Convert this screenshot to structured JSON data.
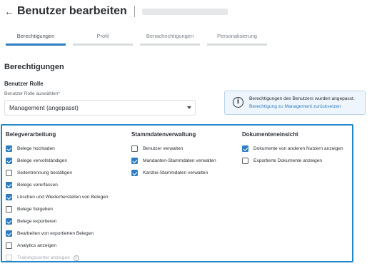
{
  "header": {
    "back_icon": "arrow-left-icon",
    "title": "Benutzer bearbeiten"
  },
  "tabs": [
    {
      "label": "Berechtigungen",
      "active": true
    },
    {
      "label": "Profil",
      "active": false
    },
    {
      "label": "Benachrichtigungen",
      "active": false
    },
    {
      "label": "Personalisierung",
      "active": false
    }
  ],
  "section_title": "Berechtigungen",
  "role": {
    "heading": "Benutzer Rolle",
    "select_label": "Benutzer Rolle auswählen*",
    "value": "Management (angepasst)"
  },
  "info": {
    "icon": "info-icon",
    "text": "Berechtigungen des Benutzers wurden angepasst.",
    "link": "Berechtigung zu Management zurücksetzen"
  },
  "columns": [
    {
      "title": "Belegverarbeitung",
      "items": [
        {
          "label": "Belege hochladen",
          "checked": true
        },
        {
          "label": "Belege vervollständigen",
          "checked": true
        },
        {
          "label": "Seitentrennung bestätigen",
          "checked": false
        },
        {
          "label": "Belege vorerfassen",
          "checked": true
        },
        {
          "label": "Löschen und Wiederherstellen von Belegen",
          "checked": true
        },
        {
          "label": "Belege freigeben",
          "checked": false
        },
        {
          "label": "Belege exportieren",
          "checked": true
        },
        {
          "label": "Bearbeiten von exportierten Belegen",
          "checked": true
        },
        {
          "label": "Analytics anzeigen",
          "checked": false
        },
        {
          "label": "Trainingscenter anzeigen",
          "checked": false,
          "disabled": true,
          "help_icon": "help-circle-icon"
        }
      ]
    },
    {
      "title": "Stammdatenverwaltung",
      "items": [
        {
          "label": "Benutzer verwalten",
          "checked": false
        },
        {
          "label": "Mandanten-Stammdaten verwalten",
          "checked": true
        },
        {
          "label": "Kanzlei-Stammdaten verwalten",
          "checked": true
        }
      ]
    },
    {
      "title": "Dokumenteneinsicht",
      "items": [
        {
          "label": "Dokumente von anderen Nutzern anzeigen",
          "checked": true
        },
        {
          "label": "Exportierte Dokumente anzeigen",
          "checked": false
        }
      ]
    }
  ],
  "colors": {
    "accent": "#2e7dc2",
    "highlight_border": "#1e87c8",
    "info_bg": "#eef5fc"
  }
}
